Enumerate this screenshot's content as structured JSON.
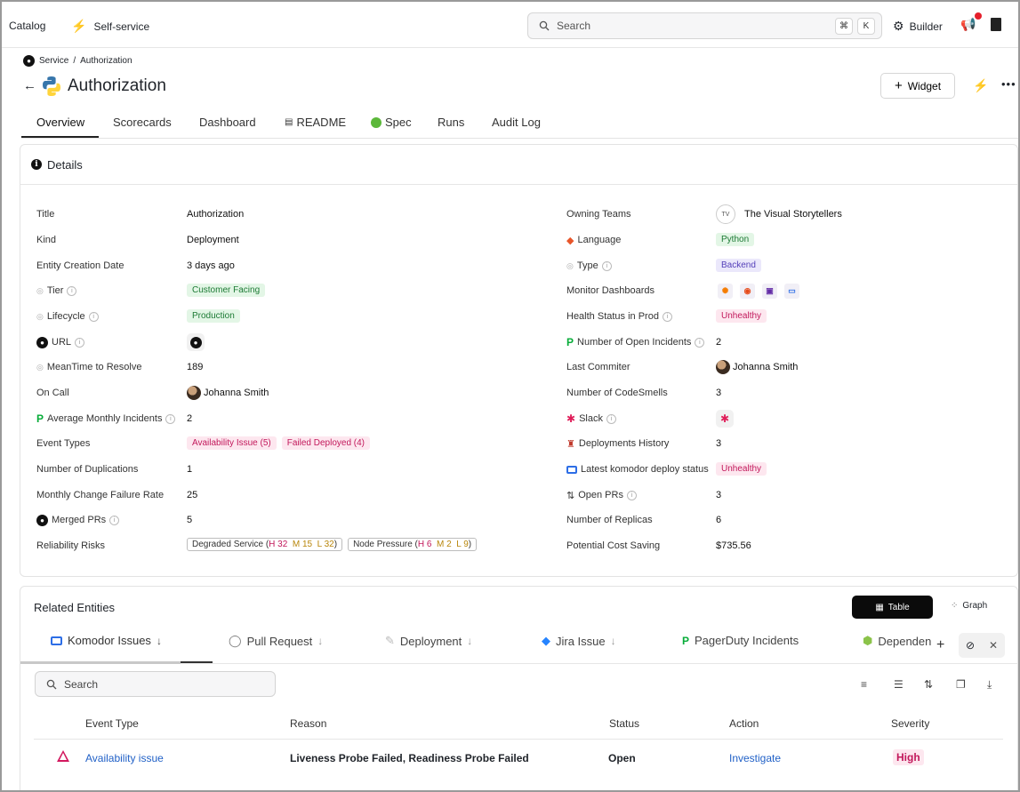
{
  "topbar": {
    "catalog": "Catalog",
    "self_service": "Self-service",
    "search_placeholder": "Search",
    "kbd_cmd": "⌘",
    "kbd_k": "K",
    "builder": "Builder"
  },
  "header": {
    "breadcrumb_service": "Service",
    "breadcrumb_sep": "/",
    "breadcrumb_current": "Authorization",
    "title": "Authorization",
    "widget_button": "Widget"
  },
  "tabs": [
    "Overview",
    "Scorecards",
    "Dashboard",
    "README",
    "Spec",
    "Runs",
    "Audit Log"
  ],
  "details": {
    "heading": "Details",
    "left": [
      {
        "label": "Title",
        "value": "Authorization"
      },
      {
        "label": "Kind",
        "value": "Deployment"
      },
      {
        "label": "Entity Creation Date",
        "value": "3 days ago"
      },
      {
        "label": "Tier",
        "value": "Customer Facing"
      },
      {
        "label": "Lifecycle",
        "value": "Production"
      },
      {
        "label": "URL",
        "value": ""
      },
      {
        "label": "MeanTime to Resolve",
        "value": "189"
      },
      {
        "label": "On Call",
        "value": "Johanna Smith"
      },
      {
        "label": "Average Monthly Incidents",
        "value": "2"
      },
      {
        "label": "Event Types",
        "value": ""
      },
      {
        "label": "Number of Duplications",
        "value": "1"
      },
      {
        "label": "Monthly Change Failure Rate",
        "value": "25"
      },
      {
        "label": "Merged PRs",
        "value": "5"
      },
      {
        "label": "Reliability Risks",
        "value": ""
      }
    ],
    "event_types": [
      "Availability Issue  (5)",
      "Failed Deployed  (4)"
    ],
    "risks": [
      {
        "name": "Degraded Service (",
        "h": "H 32",
        "m": "M 15",
        "l": "L 32",
        "close": ")"
      },
      {
        "name": "Node Pressure (",
        "h": "H 6",
        "m": "M 2",
        "l": "L 9",
        "close": ")"
      }
    ],
    "right": [
      {
        "label": "Owning Teams",
        "value": "The Visual Storytellers"
      },
      {
        "label": "Language",
        "value": "Python"
      },
      {
        "label": "Type",
        "value": "Backend"
      },
      {
        "label": "Monitor Dashboards",
        "value": ""
      },
      {
        "label": "Health Status in Prod",
        "value": "Unhealthy"
      },
      {
        "label": "Number of Open Incidents",
        "value": "2"
      },
      {
        "label": "Last Commiter",
        "value": "Johanna Smith"
      },
      {
        "label": "Number of CodeSmells",
        "value": "3"
      },
      {
        "label": "Slack",
        "value": ""
      },
      {
        "label": "Deployments History",
        "value": "3"
      },
      {
        "label": "Latest komodor deploy status",
        "value": "Unhealthy"
      },
      {
        "label": "Open PRs",
        "value": "3"
      },
      {
        "label": "Number of Replicas",
        "value": "6"
      },
      {
        "label": "Potential Cost Saving",
        "value": "$735.56"
      }
    ],
    "team_initials": "TV"
  },
  "related": {
    "title": "Related Entities",
    "table_toggle": "Table",
    "graph_toggle": "Graph",
    "tabs": [
      "Komodor Issues",
      "Pull Request",
      "Deployment",
      "Jira Issue",
      "PagerDuty Incidents",
      "Dependen"
    ],
    "search_placeholder": "Search",
    "columns": [
      "Event Type",
      "Reason",
      "Status",
      "Action",
      "Severity"
    ],
    "rows": [
      {
        "event_type": "Availability issue",
        "reason": "Liveness Probe Failed, Readiness Probe Failed",
        "status": "Open",
        "action": "Investigate",
        "severity": "High"
      }
    ]
  }
}
